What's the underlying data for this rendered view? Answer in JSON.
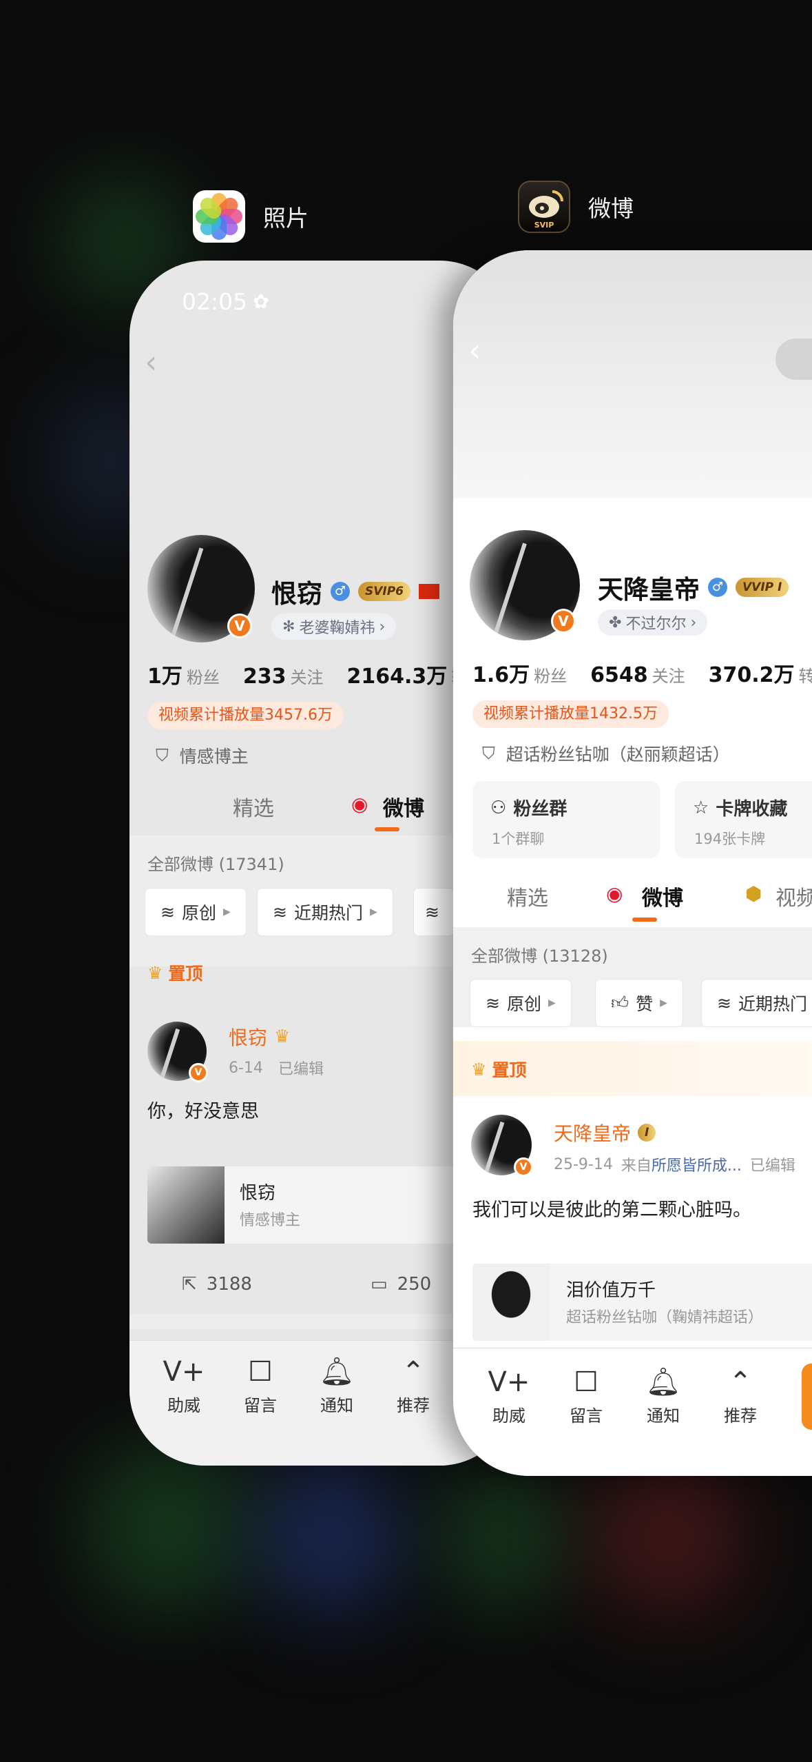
{
  "background_apps": [],
  "photos_app": {
    "label": "照片",
    "icon": "photos-icon"
  },
  "weibo_app": {
    "label": "微博",
    "icon": "weibo-svip-icon",
    "icon_text": "SVIP"
  },
  "card1": {
    "status_time": "02:05",
    "status_icon": "paw-icon",
    "profile": {
      "name": "恨窃",
      "vip_badge": "SVIP6",
      "relation_pill": "老婆鞠婧祎",
      "stats": [
        {
          "value": "1万",
          "label": "粉丝"
        },
        {
          "value": "233",
          "label": "关注"
        },
        {
          "value": "2164.3万",
          "label": "转"
        }
      ],
      "tag": "视频累计播放量3457.6万",
      "identity": "情感博主"
    },
    "tabs": [
      {
        "label": "精选",
        "active": false
      },
      {
        "label": "微博",
        "active": true
      }
    ],
    "all_posts": "全部微博 (17341)",
    "filters": [
      {
        "icon": "layers-icon",
        "label": "原创"
      },
      {
        "icon": "layers-icon",
        "label": "近期热门"
      }
    ],
    "pinned_label": "置顶",
    "post": {
      "author": "恨窃",
      "date": "6-14",
      "edited": "已编辑",
      "text": "你，好没意思",
      "share_title": "恨窃",
      "share_subtitle": "情感博主",
      "reposts": "3188",
      "comments": "250"
    },
    "nav": [
      {
        "icon": "v-plus-icon",
        "label": "助威"
      },
      {
        "icon": "message-icon",
        "label": "留言"
      },
      {
        "icon": "bell-plus-icon",
        "label": "通知"
      },
      {
        "icon": "chevron-up-circle-icon",
        "label": "推荐"
      }
    ]
  },
  "card2": {
    "profile": {
      "name": "天降皇帝",
      "vip_badge": "VVIP I",
      "relation_pill": "不过尔尔",
      "stats": [
        {
          "value": "1.6万",
          "label": "粉丝"
        },
        {
          "value": "6548",
          "label": "关注"
        },
        {
          "value": "370.2万",
          "label": "转"
        }
      ],
      "tag": "视频累计播放量1432.5万",
      "identity": "超话粉丝钻咖（赵丽颖超话）"
    },
    "groups": [
      {
        "icon": "people-icon",
        "title": "粉丝群",
        "sub": "1个群聊"
      },
      {
        "icon": "card-star-icon",
        "title": "卡牌收藏",
        "sub": "194张卡牌"
      }
    ],
    "tabs": [
      {
        "label": "精选",
        "active": false
      },
      {
        "label": "微博",
        "active": true
      },
      {
        "label": "视频",
        "active": false
      }
    ],
    "all_posts": "全部微博 (13128)",
    "filters": [
      {
        "icon": "layers-icon",
        "label": "原创"
      },
      {
        "icon": "thumb-up-icon",
        "label": "赞"
      },
      {
        "icon": "layers-icon",
        "label": "近期热门"
      }
    ],
    "pinned_label": "置顶",
    "post": {
      "author": "天降皇帝",
      "badge": "I",
      "date": "25-9-14",
      "source_prefix": "来自",
      "source": "所愿皆所成...",
      "edited": "已编辑",
      "text": "我们可以是彼此的第二颗心脏吗。",
      "share_title": "泪价值万千",
      "share_subtitle": "超话粉丝钻咖（鞠婧祎超话）"
    },
    "nav": [
      {
        "icon": "v-plus-icon",
        "label": "助威"
      },
      {
        "icon": "message-icon",
        "label": "留言"
      },
      {
        "icon": "bell-plus-icon",
        "label": "通知"
      },
      {
        "icon": "chevron-up-circle-icon",
        "label": "推荐"
      }
    ]
  }
}
